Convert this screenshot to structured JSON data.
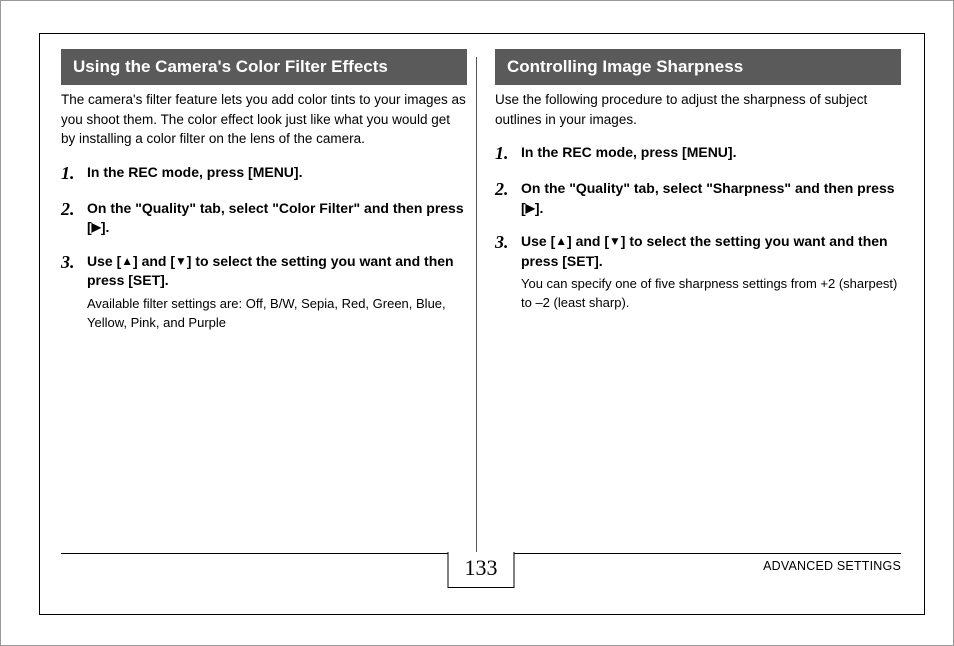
{
  "left": {
    "heading": "Using the Camera's Color Filter Effects",
    "intro": "The camera's filter feature lets you add color tints to your images as you shoot them. The color effect look just like what you would get by installing a color filter on the lens of the camera.",
    "steps": [
      {
        "num": "1.",
        "title": "In the REC mode, press [MENU]."
      },
      {
        "num": "2.",
        "title_pre": "On the \"Quality\" tab, select \"Color Filter\" and then press [",
        "title_post": "]."
      },
      {
        "num": "3.",
        "title_pre": "Use [",
        "title_mid": "] and [",
        "title_post": "] to select the setting you want and then press [SET].",
        "note": "Available filter settings are: Off, B/W, Sepia, Red, Green, Blue, Yellow, Pink, and Purple"
      }
    ]
  },
  "right": {
    "heading": "Controlling Image Sharpness",
    "intro": "Use the following procedure to adjust the sharpness of subject outlines in your images.",
    "steps": [
      {
        "num": "1.",
        "title": "In the REC mode, press [MENU]."
      },
      {
        "num": "2.",
        "title_pre": "On the \"Quality\" tab, select \"Sharpness\" and then press [",
        "title_post": "]."
      },
      {
        "num": "3.",
        "title_pre": "Use [",
        "title_mid": "] and [",
        "title_post": "] to select the setting you want and then press [SET].",
        "note": "You can specify one of five sharpness settings from +2 (sharpest) to –2 (least sharp)."
      }
    ]
  },
  "footer": {
    "page_number": "133",
    "section_label": "ADVANCED SETTINGS"
  },
  "glyphs": {
    "right": "▶",
    "up": "▲",
    "down": "▼"
  }
}
